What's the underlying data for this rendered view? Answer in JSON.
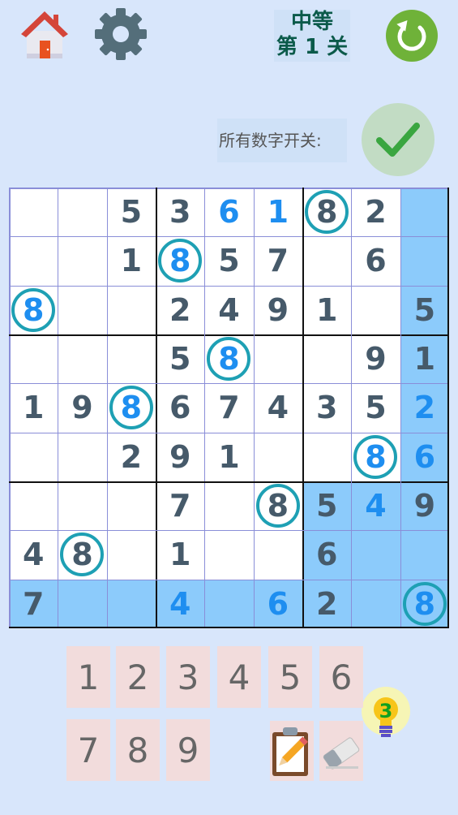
{
  "header": {
    "difficulty": "中等",
    "level": "第 1 关"
  },
  "toggle": {
    "label": "所有数字开关:",
    "state": "on"
  },
  "board": {
    "cells": [
      [
        "",
        "",
        "5",
        "3",
        "6",
        "1",
        "8",
        "2",
        ""
      ],
      [
        "",
        "",
        "1",
        "8",
        "5",
        "7",
        "",
        "6",
        ""
      ],
      [
        "8",
        "",
        "",
        "2",
        "4",
        "9",
        "1",
        "",
        "5"
      ],
      [
        "",
        "",
        "",
        "5",
        "8",
        "",
        "",
        "9",
        "1"
      ],
      [
        "1",
        "9",
        "8",
        "6",
        "7",
        "4",
        "3",
        "5",
        "2"
      ],
      [
        "",
        "",
        "2",
        "9",
        "1",
        "",
        "",
        "8",
        "6"
      ],
      [
        "",
        "",
        "",
        "7",
        "",
        "8",
        "5",
        "4",
        "9"
      ],
      [
        "4",
        "8",
        "",
        "1",
        "",
        "",
        "6",
        "",
        ""
      ],
      [
        "7",
        "",
        "",
        "4",
        "",
        "6",
        "2",
        "",
        "8"
      ]
    ],
    "user_entered": [
      [
        0,
        4
      ],
      [
        0,
        5
      ],
      [
        2,
        0
      ],
      [
        3,
        4
      ],
      [
        1,
        3
      ],
      [
        4,
        2
      ],
      [
        4,
        8
      ],
      [
        5,
        7
      ],
      [
        5,
        8
      ],
      [
        6,
        7
      ],
      [
        8,
        3
      ],
      [
        8,
        5
      ],
      [
        8,
        8
      ],
      [
        0,
        6
      ]
    ],
    "given_override": [
      [
        0,
        6
      ]
    ],
    "circled": [
      [
        0,
        6
      ],
      [
        1,
        3
      ],
      [
        2,
        0
      ],
      [
        3,
        4
      ],
      [
        4,
        2
      ],
      [
        5,
        7
      ],
      [
        6,
        5
      ],
      [
        7,
        1
      ],
      [
        8,
        8
      ]
    ],
    "highlighted": [
      [
        0,
        8
      ],
      [
        1,
        8
      ],
      [
        2,
        8
      ],
      [
        3,
        8
      ],
      [
        4,
        8
      ],
      [
        5,
        8
      ],
      [
        6,
        8
      ],
      [
        7,
        8
      ],
      [
        8,
        8
      ],
      [
        8,
        0
      ],
      [
        8,
        1
      ],
      [
        8,
        2
      ],
      [
        8,
        3
      ],
      [
        8,
        4
      ],
      [
        8,
        5
      ],
      [
        8,
        6
      ],
      [
        8,
        7
      ],
      [
        6,
        6
      ],
      [
        6,
        7
      ],
      [
        7,
        6
      ],
      [
        7,
        7
      ]
    ]
  },
  "keypad": {
    "digits": [
      "1",
      "2",
      "3",
      "4",
      "5",
      "6",
      "7",
      "8",
      "9"
    ]
  },
  "tools": {
    "hint_count": "3"
  },
  "icons": {
    "home": "home-icon",
    "settings": "gear-icon",
    "refresh": "refresh-icon",
    "toggle": "check-icon",
    "note": "clipboard-pencil-icon",
    "erase": "eraser-icon",
    "hint": "lightbulb-icon"
  },
  "colors": {
    "background": "#d8e6fb",
    "highlight": "#8ccbfb",
    "given_digit": "#465a6a",
    "user_digit": "#1e8ef0",
    "ring": "#1ea0b4",
    "keypad": "#f2dcdc"
  }
}
